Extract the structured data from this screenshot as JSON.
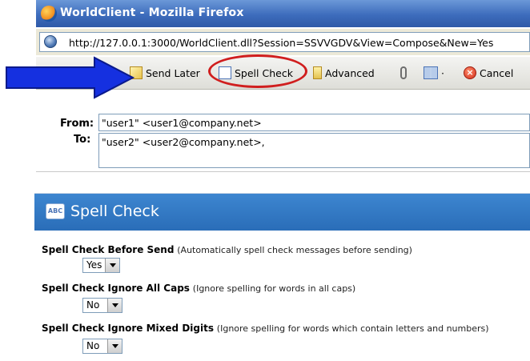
{
  "browser": {
    "title": "WorldClient - Mozilla Firefox",
    "url": "http://127.0.0.1:3000/WorldClient.dll?Session=SSVVGDV&View=Compose&New=Yes"
  },
  "toolbar": {
    "send_later": "Send Later",
    "spell_check": "Spell Check",
    "advanced": "Advanced",
    "separator": "·",
    "cancel": "Cancel"
  },
  "compose": {
    "from_label": "From:",
    "from_value": "\"user1\" <user1@company.net>",
    "to_label": "To:",
    "to_value": "\"user2\" <user2@company.net>,"
  },
  "spell_panel": {
    "title": "Spell Check",
    "icon_text": "ABC",
    "options": [
      {
        "title": "Spell Check Before Send",
        "description": "(Automatically spell check messages before sending)",
        "value": "Yes"
      },
      {
        "title": "Spell Check Ignore All Caps",
        "description": "(Ignore spelling for words in all caps)",
        "value": "No"
      },
      {
        "title": "Spell Check Ignore Mixed Digits",
        "description": "(Ignore spelling for words which contain letters and numbers)",
        "value": "No"
      }
    ]
  },
  "colors": {
    "highlight_circle": "#d01e1e",
    "arrow": "#1530e0",
    "panel_header": "#2a6db8"
  }
}
